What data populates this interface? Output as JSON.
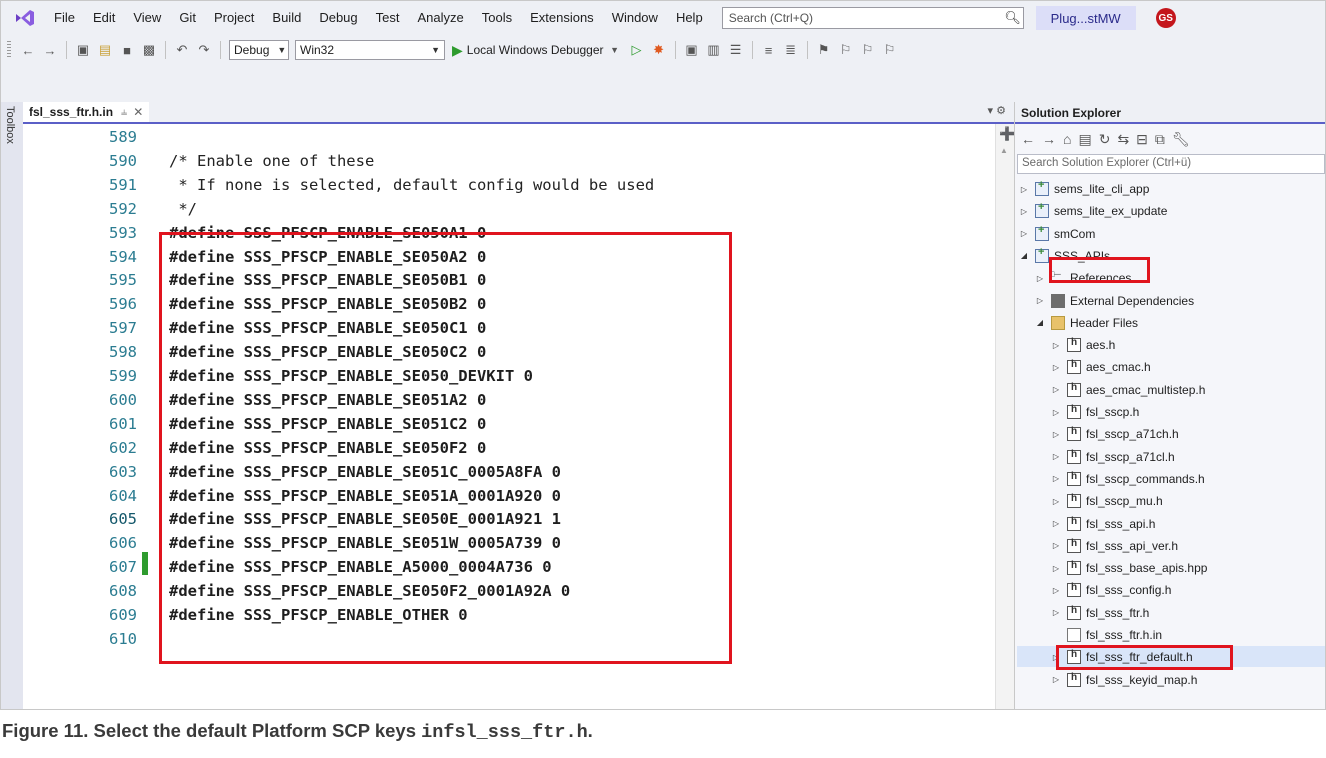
{
  "menu": {
    "items": [
      "File",
      "Edit",
      "View",
      "Git",
      "Project",
      "Build",
      "Debug",
      "Test",
      "Analyze",
      "Tools",
      "Extensions",
      "Window",
      "Help"
    ],
    "search_placeholder": "Search (Ctrl+Q)",
    "solution_name": "Plug...stMW",
    "avatar_initials": "GS"
  },
  "toolbar": {
    "config": "Debug",
    "platform": "Win32",
    "run_label": "Local Windows Debugger"
  },
  "toolbox_label": "Toolbox",
  "editor": {
    "tab_label": "fsl_sss_ftr.h.in",
    "lines": [
      {
        "num": "589",
        "text": ""
      },
      {
        "num": "590",
        "text": "/* Enable one of these",
        "kind": "comment"
      },
      {
        "num": "591",
        "text": " * If none is selected, default config would be used",
        "kind": "comment"
      },
      {
        "num": "592",
        "text": " */",
        "kind": "comment"
      },
      {
        "num": "593",
        "text": "#define SSS_PFSCP_ENABLE_SE050A1 0"
      },
      {
        "num": "594",
        "text": "#define SSS_PFSCP_ENABLE_SE050A2 0"
      },
      {
        "num": "595",
        "text": "#define SSS_PFSCP_ENABLE_SE050B1 0"
      },
      {
        "num": "596",
        "text": "#define SSS_PFSCP_ENABLE_SE050B2 0"
      },
      {
        "num": "597",
        "text": "#define SSS_PFSCP_ENABLE_SE050C1 0"
      },
      {
        "num": "598",
        "text": "#define SSS_PFSCP_ENABLE_SE050C2 0"
      },
      {
        "num": "599",
        "text": "#define SSS_PFSCP_ENABLE_SE050_DEVKIT 0"
      },
      {
        "num": "600",
        "text": "#define SSS_PFSCP_ENABLE_SE051A2 0"
      },
      {
        "num": "601",
        "text": "#define SSS_PFSCP_ENABLE_SE051C2 0"
      },
      {
        "num": "602",
        "text": "#define SSS_PFSCP_ENABLE_SE050F2 0"
      },
      {
        "num": "603",
        "text": "#define SSS_PFSCP_ENABLE_SE051C_0005A8FA 0"
      },
      {
        "num": "604",
        "text": "#define SSS_PFSCP_ENABLE_SE051A_0001A920 0"
      },
      {
        "num": "605",
        "text": "#define SSS_PFSCP_ENABLE_SE050E_0001A921 1",
        "changed": true
      },
      {
        "num": "606",
        "text": "#define SSS_PFSCP_ENABLE_SE051W_0005A739 0"
      },
      {
        "num": "607",
        "text": "#define SSS_PFSCP_ENABLE_A5000_0004A736 0"
      },
      {
        "num": "608",
        "text": "#define SSS_PFSCP_ENABLE_SE050F2_0001A92A 0"
      },
      {
        "num": "609",
        "text": "#define SSS_PFSCP_ENABLE_OTHER 0"
      },
      {
        "num": "610",
        "text": ""
      }
    ]
  },
  "solution_explorer": {
    "title": "Solution Explorer",
    "search_placeholder": "Search Solution Explorer (Ctrl+ü)",
    "items": [
      {
        "label": "sems_lite_cli_app",
        "icon": "project-icon",
        "indent": 0,
        "expander": "collapsed"
      },
      {
        "label": "sems_lite_ex_update",
        "icon": "project-icon",
        "indent": 0,
        "expander": "collapsed"
      },
      {
        "label": "smCom",
        "icon": "project-icon",
        "indent": 0,
        "expander": "collapsed"
      },
      {
        "label": "SSS_APIs",
        "icon": "project-icon",
        "indent": 0,
        "expander": "expanded"
      },
      {
        "label": "References",
        "icon": "references-icon",
        "indent": 1,
        "expander": "collapsed"
      },
      {
        "label": "External Dependencies",
        "icon": "external-dependencies-icon",
        "indent": 1,
        "expander": "collapsed"
      },
      {
        "label": "Header Files",
        "icon": "folder-icon",
        "indent": 1,
        "expander": "expanded"
      },
      {
        "label": "aes.h",
        "icon": "header-file-icon",
        "indent": 2,
        "expander": "collapsed"
      },
      {
        "label": "aes_cmac.h",
        "icon": "header-file-icon",
        "indent": 2,
        "expander": "collapsed"
      },
      {
        "label": "aes_cmac_multistep.h",
        "icon": "header-file-icon",
        "indent": 2,
        "expander": "collapsed"
      },
      {
        "label": "fsl_sscp.h",
        "icon": "header-file-icon",
        "indent": 2,
        "expander": "collapsed"
      },
      {
        "label": "fsl_sscp_a71ch.h",
        "icon": "header-file-icon",
        "indent": 2,
        "expander": "collapsed"
      },
      {
        "label": "fsl_sscp_a71cl.h",
        "icon": "header-file-icon",
        "indent": 2,
        "expander": "collapsed"
      },
      {
        "label": "fsl_sscp_commands.h",
        "icon": "header-file-icon",
        "indent": 2,
        "expander": "collapsed"
      },
      {
        "label": "fsl_sscp_mu.h",
        "icon": "header-file-icon",
        "indent": 2,
        "expander": "collapsed"
      },
      {
        "label": "fsl_sss_api.h",
        "icon": "header-file-icon",
        "indent": 2,
        "expander": "collapsed"
      },
      {
        "label": "fsl_sss_api_ver.h",
        "icon": "header-file-icon",
        "indent": 2,
        "expander": "collapsed"
      },
      {
        "label": "fsl_sss_base_apis.hpp",
        "icon": "header-file-icon",
        "indent": 2,
        "expander": "collapsed"
      },
      {
        "label": "fsl_sss_config.h",
        "icon": "header-file-icon",
        "indent": 2,
        "expander": "collapsed"
      },
      {
        "label": "fsl_sss_ftr.h",
        "icon": "header-file-icon",
        "indent": 2,
        "expander": "collapsed"
      },
      {
        "label": "fsl_sss_ftr.h.in",
        "icon": "file-icon",
        "indent": 2,
        "expander": "none",
        "selected": true
      },
      {
        "label": "fsl_sss_ftr_default.h",
        "icon": "header-file-icon",
        "indent": 2,
        "expander": "collapsed"
      },
      {
        "label": "fsl_sss_keyid_map.h",
        "icon": "header-file-icon",
        "indent": 2,
        "expander": "collapsed"
      }
    ]
  },
  "caption": {
    "prefix": "Figure 11.   Select the default Platform SCP keys ",
    "code": "infsl_sss_ftr.h",
    "suffix": "."
  },
  "colors": {
    "highlight_box": "#e0141e",
    "line_number": "#2b7c91",
    "accent": "#5b5fc7",
    "change_bar": "#2e9b2e"
  }
}
